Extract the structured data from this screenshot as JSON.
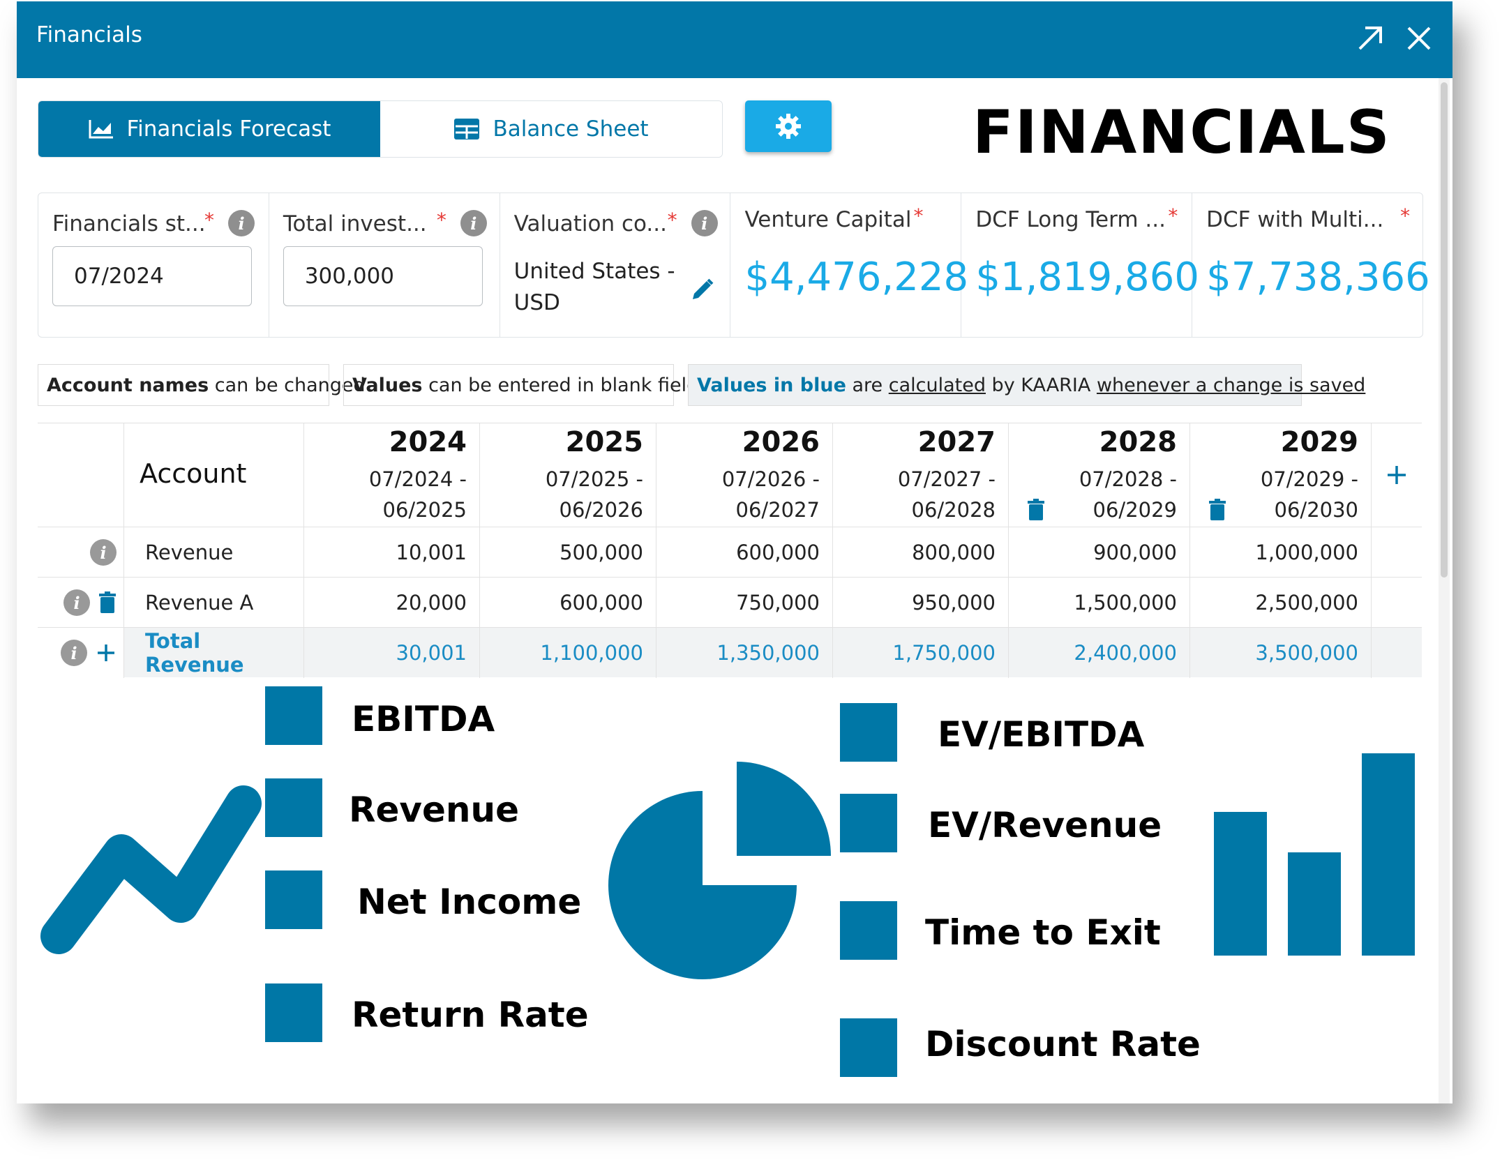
{
  "window": {
    "title": "Financials"
  },
  "tabs": [
    {
      "label": "Financials Forecast",
      "icon": "line-chart-icon",
      "active": true
    },
    {
      "label": "Balance Sheet",
      "icon": "table-grid-icon",
      "active": false
    }
  ],
  "brand": "FINANCIALS",
  "fields": {
    "start": {
      "label": "Financials st...",
      "value": "07/2024"
    },
    "investment": {
      "label": "Total invest...",
      "value": "300,000"
    },
    "valuation": {
      "label": "Valuation co...",
      "value_line1": "United States -",
      "value_line2": "USD"
    },
    "vc": {
      "label": "Venture Capital",
      "value": "$4,476,228"
    },
    "dcf_long": {
      "label": "DCF Long Term ...",
      "value": "$1,819,860"
    },
    "dcf_multi": {
      "label": "DCF with Multi...",
      "value": "$7,738,366"
    },
    "required_mark": "*",
    "info_glyph": "i"
  },
  "notes": {
    "n1_bold": "Account names",
    "n1_rest": " can be changed",
    "n2_bold": "Values",
    "n2_rest": " can be entered in blank fields",
    "n3_blue": "Values in blue",
    "n3_a": " are ",
    "n3_link1": "calculated",
    "n3_b": " by KAARIA ",
    "n3_link2": "whenever a change is saved"
  },
  "table": {
    "account_header": "Account",
    "years": [
      {
        "year": "2024",
        "p1": "07/2024 -",
        "p2": "06/2025"
      },
      {
        "year": "2025",
        "p1": "07/2025 -",
        "p2": "06/2026"
      },
      {
        "year": "2026",
        "p1": "07/2026 -",
        "p2": "06/2027"
      },
      {
        "year": "2027",
        "p1": "07/2027 -",
        "p2": "06/2028"
      },
      {
        "year": "2028",
        "p1": "07/2028 -",
        "p2": "06/2029"
      },
      {
        "year": "2029",
        "p1": "07/2029 -",
        "p2": "06/2030"
      }
    ],
    "rows": [
      {
        "name": "Revenue",
        "values": [
          "10,001",
          "500,000",
          "600,000",
          "800,000",
          "900,000",
          "1,000,000"
        ]
      },
      {
        "name": "Revenue A",
        "values": [
          "20,000",
          "600,000",
          "750,000",
          "950,000",
          "1,500,000",
          "2,500,000"
        ]
      },
      {
        "name": "Total Revenue",
        "values": [
          "30,001",
          "1,100,000",
          "1,350,000",
          "1,750,000",
          "2,400,000",
          "3,500,000"
        ]
      }
    ]
  },
  "legend_left": [
    "EBITDA",
    "Revenue",
    "Net Income",
    "Return Rate"
  ],
  "legend_right": [
    "EV/EBITDA",
    "EV/Revenue",
    "Time to Exit",
    "Discount Rate"
  ],
  "colors": {
    "primary": "#0277a8",
    "accent": "#1aaae6",
    "legend": "#0077a6",
    "required": "#e53935"
  }
}
